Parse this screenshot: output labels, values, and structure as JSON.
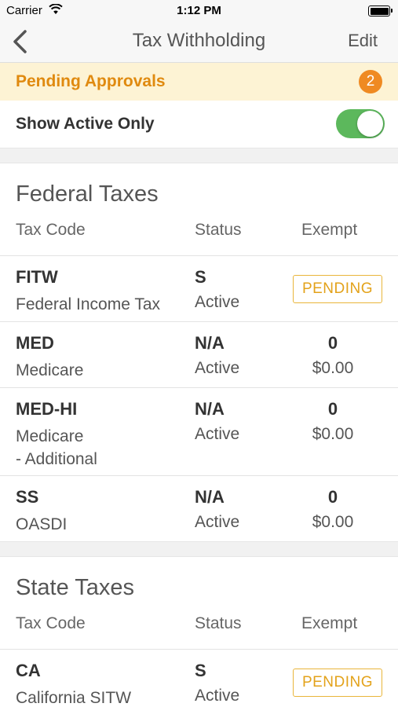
{
  "status_bar": {
    "carrier": "Carrier",
    "time": "1:12 PM"
  },
  "nav": {
    "title": "Tax Withholding",
    "edit_label": "Edit"
  },
  "pending": {
    "label": "Pending Approvals",
    "count": "2"
  },
  "filter": {
    "label": "Show Active Only",
    "enabled": true
  },
  "columns": {
    "code": "Tax Code",
    "status": "Status",
    "exempt": "Exempt"
  },
  "federal": {
    "title": "Federal Taxes",
    "rows": [
      {
        "code": "FITW",
        "desc": "Federal Income Tax",
        "status_code": "S",
        "status": "Active",
        "exempt_badge": "PENDING"
      },
      {
        "code": "MED",
        "desc": "Medicare",
        "status_code": "N/A",
        "status": "Active",
        "exempt_num": "0",
        "exempt_amt": "$0.00"
      },
      {
        "code": "MED-HI",
        "desc_line1": "Medicare",
        "desc_line2": "- Additional",
        "status_code": "N/A",
        "status": "Active",
        "exempt_num": "0",
        "exempt_amt": "$0.00"
      },
      {
        "code": "SS",
        "desc": "OASDI",
        "status_code": "N/A",
        "status": "Active",
        "exempt_num": "0",
        "exempt_amt": "$0.00"
      }
    ]
  },
  "state": {
    "title": "State Taxes",
    "rows": [
      {
        "code": "CA",
        "desc": "California SITW",
        "status_code": "S",
        "status": "Active",
        "exempt_badge": "PENDING"
      }
    ]
  },
  "colors": {
    "accent_orange": "#ef8a22",
    "banner_bg": "#fdf3d4",
    "toggle_on": "#5cb85c",
    "badge_border": "#e9b53a"
  }
}
